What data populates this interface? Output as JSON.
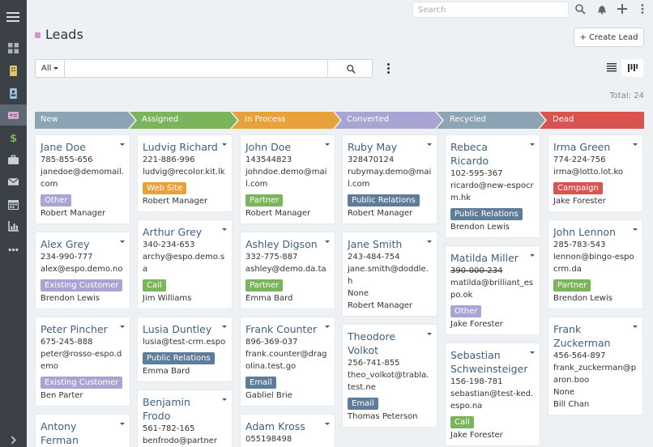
{
  "sidebar": {
    "icons": [
      "menu-icon",
      "home-icon",
      "account-icon",
      "contact-icon",
      "lead-icon",
      "dollar-icon",
      "case-icon",
      "email-icon",
      "calendar-icon",
      "report-icon",
      "more-icon",
      "chevron-right-icon"
    ]
  },
  "topbar": {
    "search_placeholder": "Search"
  },
  "page": {
    "title": "Leads",
    "create_label": "+ Create Lead",
    "filter_label": "All",
    "total_label": "Total: 24"
  },
  "colors": {
    "new": "#8ca4b3",
    "assigned": "#7ab55c",
    "inprocess": "#e9a23b",
    "converted": "#a8a4d4",
    "recycled": "#8ca4b3",
    "dead": "#d9534f",
    "partner": "#7ab55c",
    "public_relations": "#5e7d9c",
    "other": "#a8a4d4",
    "existing_customer": "#a8a4d4",
    "web_site": "#e9a23b",
    "call": "#7ab55c",
    "email": "#5e7d9c",
    "campaign": "#d9534f"
  },
  "stages": [
    "New",
    "Assigned",
    "In Process",
    "Converted",
    "Recycled",
    "Dead"
  ],
  "columns": [
    {
      "cards": [
        {
          "name": "Jane Doe",
          "lines": [
            "785-855-656",
            "janedoe@demomail.com"
          ],
          "tag": "Other",
          "tagColor": "#a8a4d4",
          "user": "Robert Manager"
        },
        {
          "name": "Alex Grey",
          "lines": [
            "234-990-777",
            "alex@espo.demo.no"
          ],
          "tag": "Existing Customer",
          "tagColor": "#a8a4d4",
          "user": "Brendon Lewis"
        },
        {
          "name": "Peter Pincher",
          "lines": [
            "675-245-888",
            "peter@rosso-espo.demo"
          ],
          "tag": "Existing Customer",
          "tagColor": "#a8a4d4",
          "user": "Ben Parter"
        },
        {
          "name": "Antony Ferman",
          "lines": [],
          "tag": "",
          "tagColor": "",
          "user": ""
        }
      ]
    },
    {
      "cards": [
        {
          "name": "Ludvig Richard",
          "lines": [
            "221-886-996",
            "ludvig@recolor.kit.lk"
          ],
          "tag": "Web Site",
          "tagColor": "#e9a23b",
          "user": "Robert Manager"
        },
        {
          "name": "Arthur Grey",
          "lines": [
            "340-234-653",
            "archy@espo.demo.sa"
          ],
          "tag": "Call",
          "tagColor": "#7ab55c",
          "user": "Jim Williams"
        },
        {
          "name": "Lusia Duntley",
          "lines": [
            "lusia@test-crm.espo"
          ],
          "tag": "Public Relations",
          "tagColor": "#5e7d9c",
          "user": "Emma Bard"
        },
        {
          "name": "Benjamin Frodo",
          "lines": [
            "561-782-165",
            "benfrodo@partner"
          ],
          "tag": "",
          "tagColor": "",
          "user": ""
        }
      ]
    },
    {
      "cards": [
        {
          "name": "John Doe",
          "lines": [
            "143544823",
            "johndoe.demo@mail.com"
          ],
          "tag": "Partner",
          "tagColor": "#7ab55c",
          "user": "Robert Manager"
        },
        {
          "name": "Ashley Digson",
          "lines": [
            "332-775-887",
            "ashley@demo.da.ta"
          ],
          "tag": "Partner",
          "tagColor": "#7ab55c",
          "user": "Emma Bard"
        },
        {
          "name": "Frank Counter",
          "lines": [
            "896-369-037",
            "frank.counter@dragolina.test.go"
          ],
          "tag": "Email",
          "tagColor": "#5e7d9c",
          "user": "Gabliel Brie"
        },
        {
          "name": "Adam Kross",
          "lines": [
            "055198498"
          ],
          "tag": "",
          "tagColor": "",
          "user": ""
        }
      ]
    },
    {
      "cards": [
        {
          "name": "Ruby May",
          "lines": [
            "328470124",
            "rubymay.demo@mail.com"
          ],
          "tag": "Public Relations",
          "tagColor": "#5e7d9c",
          "user": "Robert Manager"
        },
        {
          "name": "Jane Smith",
          "lines": [
            "243-484-754",
            "jane.smith@doddle.h",
            "None"
          ],
          "tag": "",
          "tagColor": "",
          "user": "Robert Manager"
        },
        {
          "name": "Theodore Volkot",
          "lines": [
            "256-741-855",
            "theo_volkot@trabla.test.ne"
          ],
          "tag": "Email",
          "tagColor": "#5e7d9c",
          "user": "Thomas Peterson"
        }
      ]
    },
    {
      "cards": [
        {
          "name": "Rebeca Ricardo",
          "lines": [
            "102-595-367",
            "ricardo@new-espocrm.hk"
          ],
          "tag": "Public Relations",
          "tagColor": "#5e7d9c",
          "user": "Brendon Lewis"
        },
        {
          "name": "Matilda Miller",
          "lines": [
            "390-000-234",
            "matilda@brilliant_espo.ok"
          ],
          "strikeFirst": true,
          "tag": "Other",
          "tagColor": "#a8a4d4",
          "user": "Jake Forester"
        },
        {
          "name": "Sebastian Schweinsteiger",
          "lines": [
            "156-198-781",
            "sebastian@test-ked.espo.na"
          ],
          "tag": "Call",
          "tagColor": "#7ab55c",
          "user": "Jake Forester"
        }
      ]
    },
    {
      "cards": [
        {
          "name": "Irma Green",
          "lines": [
            "774-224-756",
            "irma@lotto.lot.ko"
          ],
          "tag": "Campaign",
          "tagColor": "#d9534f",
          "user": "Jake Forester"
        },
        {
          "name": "John Lennon",
          "lines": [
            "285-783-543",
            "lennon@bingo-espocrm.da"
          ],
          "tag": "Partner",
          "tagColor": "#7ab55c",
          "user": "Brendon Lewis"
        },
        {
          "name": "Frank Zuckerman",
          "lines": [
            "456-564-897",
            "frank_zuckerman@paron.boo",
            "None"
          ],
          "tag": "",
          "tagColor": "",
          "user": "Bill Chan"
        }
      ]
    }
  ]
}
